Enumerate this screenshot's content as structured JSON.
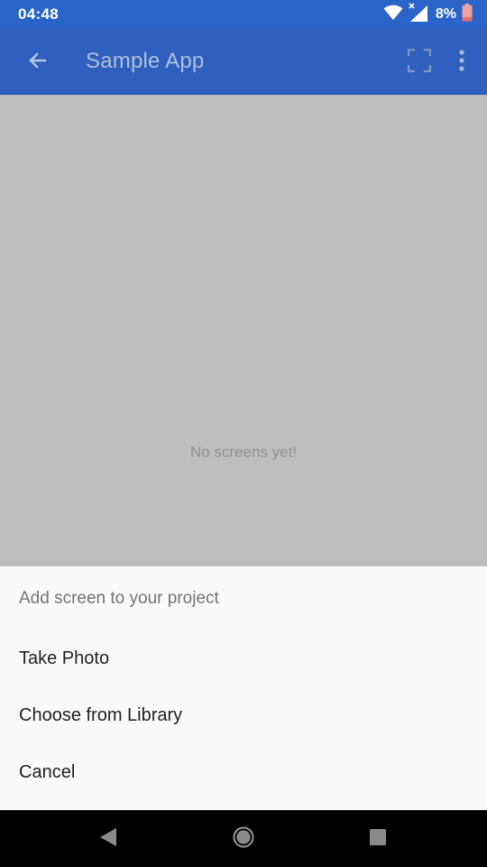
{
  "status_bar": {
    "time": "04:48",
    "battery_percent": "8%",
    "icons": [
      "wifi-icon",
      "signal-icon",
      "battery-icon"
    ]
  },
  "app_bar": {
    "title": "Sample App",
    "icons": [
      "arrow-back-icon",
      "fullscreen-icon",
      "more-vert-icon"
    ]
  },
  "content": {
    "empty_message": "No screens yet!"
  },
  "sheet": {
    "title": "Add screen to your project",
    "items": [
      {
        "label": "Take Photo"
      },
      {
        "label": "Choose from Library"
      },
      {
        "label": "Cancel"
      }
    ]
  },
  "nav_bar": {
    "icons": [
      "nav-back-icon",
      "nav-home-icon",
      "nav-recents-icon"
    ]
  },
  "colors": {
    "status_bar": "#2a64c9",
    "app_bar": "#2f60bf",
    "overlay": "#bdbdbd",
    "sheet": "#fafafa",
    "battery_low": "#f0a0a0"
  }
}
